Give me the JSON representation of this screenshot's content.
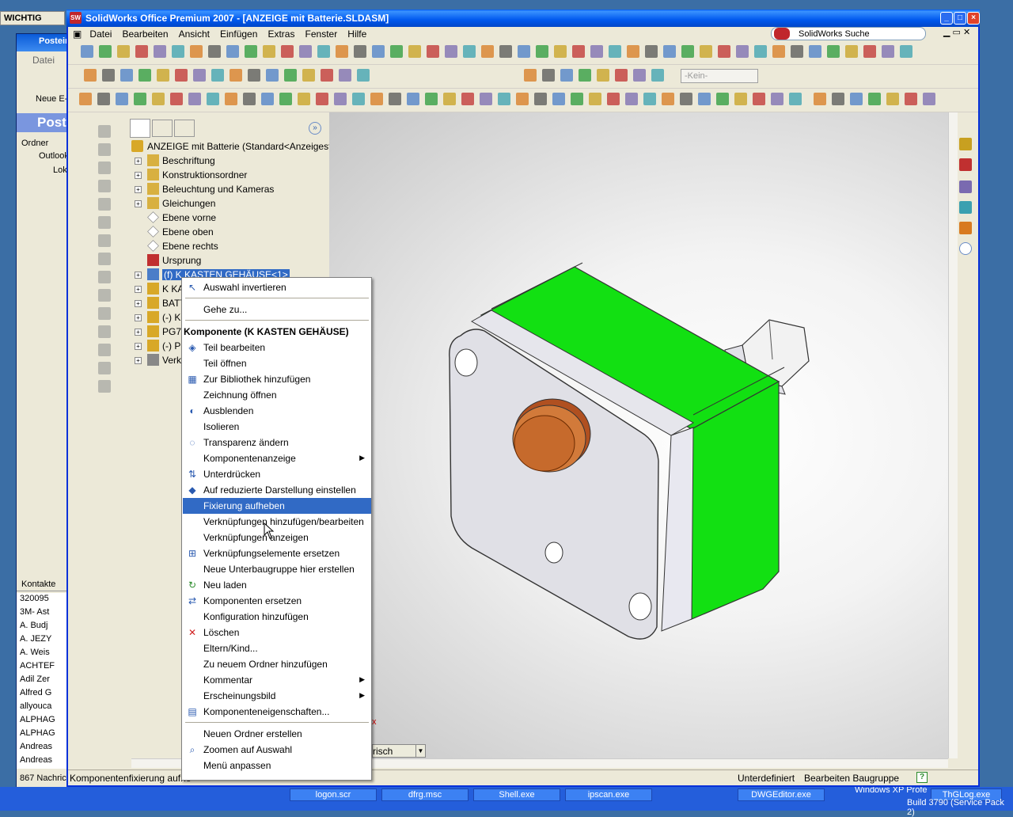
{
  "background": {
    "wichtig_label": "WICHTIG",
    "outlook_title": "Postein",
    "outlook_menu": "Datei",
    "outlook_new": "Neue E-",
    "outlook_header": "Post",
    "folders_label": "Ordner",
    "outlook_root": "Outlook",
    "outlook_sub": "Lok",
    "contacts_label": "Kontakte",
    "contacts": [
      "320095",
      "3M- Ast",
      "A. Budj",
      "A. JEZY",
      "A. Weis",
      "ACHTEF",
      "Adil Zer",
      "Alfred G",
      "allyouca",
      "ALPHAG",
      "ALPHAG",
      "Andreas",
      "Andreas"
    ],
    "message_count": "867 Nachrich",
    "taskbar_items": [
      "logon.scr",
      "dfrg.msc",
      "Shell.exe",
      "ipscan.exe",
      "DWGEditor.exe",
      "ThGLog.exe"
    ],
    "os_build": "Build 3790 (Service Pack 2)",
    "os_name": "Windows XP Profe",
    "os_suffix": "ion"
  },
  "window": {
    "title": "SolidWorks Office Premium 2007 - [ANZEIGE mit Batterie.SLDASM]",
    "menus": [
      "Datei",
      "Bearbeiten",
      "Ansicht",
      "Einfügen",
      "Extras",
      "Fenster",
      "Hilfe"
    ],
    "search_placeholder": "SolidWorks Suche",
    "config_select": "-Kein-"
  },
  "tree": {
    "root": "ANZEIGE mit Batterie  (Standard<Anzeigestatu",
    "items": [
      {
        "label": "Beschriftung",
        "expand": true
      },
      {
        "label": "Konstruktionsordner",
        "expand": true
      },
      {
        "label": "Beleuchtung und Kameras",
        "expand": true
      },
      {
        "label": "Gleichungen",
        "expand": true
      },
      {
        "label": "Ebene vorne",
        "expand": false
      },
      {
        "label": "Ebene oben",
        "expand": false
      },
      {
        "label": "Ebene rechts",
        "expand": false
      },
      {
        "label": "Ursprung",
        "expand": false
      },
      {
        "label": "(f) K KASTEN GEHÄUSE<1>",
        "expand": true
      },
      {
        "label": "K KA",
        "expand": true
      },
      {
        "label": "BATT",
        "expand": true
      },
      {
        "label": "(-) K",
        "expand": true
      },
      {
        "label": "PG7",
        "expand": true
      },
      {
        "label": "(-) P",
        "expand": true
      },
      {
        "label": "Verk",
        "expand": true
      }
    ]
  },
  "context_menu": {
    "items": [
      {
        "label": "Auswahl invertieren",
        "icon": "cursor-icon"
      },
      {
        "label": "Gehe zu..."
      },
      {
        "label": "Komponente (K KASTEN GEHÄUSE)",
        "header": true
      },
      {
        "label": "Teil bearbeiten",
        "icon": "part-edit-icon"
      },
      {
        "label": "Teil öffnen"
      },
      {
        "label": "Zur Bibliothek hinzufügen",
        "icon": "library-icon"
      },
      {
        "label": "Zeichnung öffnen"
      },
      {
        "label": "Ausblenden",
        "icon": "hide-icon"
      },
      {
        "label": "Isolieren"
      },
      {
        "label": "Transparenz ändern",
        "icon": "transparency-icon"
      },
      {
        "label": "Komponentenanzeige",
        "submenu": true
      },
      {
        "label": "Unterdrücken",
        "icon": "suppress-icon"
      },
      {
        "label": "Auf reduzierte Darstellung einstellen",
        "icon": "lightweight-icon"
      },
      {
        "label": "Fixierung aufheben",
        "highlighted": true
      },
      {
        "label": "Verknüpfungen hinzufügen/bearbeiten"
      },
      {
        "label": "Verknüpfungen anzeigen"
      },
      {
        "label": "Verknüpfungselemente ersetzen",
        "icon": "replace-mates-icon"
      },
      {
        "label": "Neue Unterbaugruppe hier erstellen"
      },
      {
        "label": "Neu laden",
        "icon": "reload-icon"
      },
      {
        "label": "Komponenten ersetzen",
        "icon": "replace-icon"
      },
      {
        "label": "Konfiguration hinzufügen"
      },
      {
        "label": "Löschen",
        "icon": "delete-icon"
      },
      {
        "label": "Eltern/Kind..."
      },
      {
        "label": "Zu neuem Ordner hinzufügen"
      },
      {
        "label": "Kommentar",
        "submenu": true
      },
      {
        "label": "Erscheinungsbild",
        "submenu": true
      },
      {
        "label": "Komponenteneigenschaften...",
        "icon": "properties-icon"
      },
      {
        "label": "Neuen Ordner erstellen"
      },
      {
        "label": "Zoomen auf Auswahl",
        "icon": "zoom-icon"
      },
      {
        "label": "Menü anpassen"
      }
    ]
  },
  "viewport": {
    "view_select": "risch"
  },
  "status": {
    "left": "Komponentenfixierung aufhe",
    "state": "Unterdefiniert",
    "mode": "Bearbeiten Baugruppe",
    "help": "?"
  },
  "colors": {
    "green": "#10e010",
    "grey_face": "#e6e6ec",
    "button_orange": "#c8642a",
    "selection": "#316ac5"
  }
}
